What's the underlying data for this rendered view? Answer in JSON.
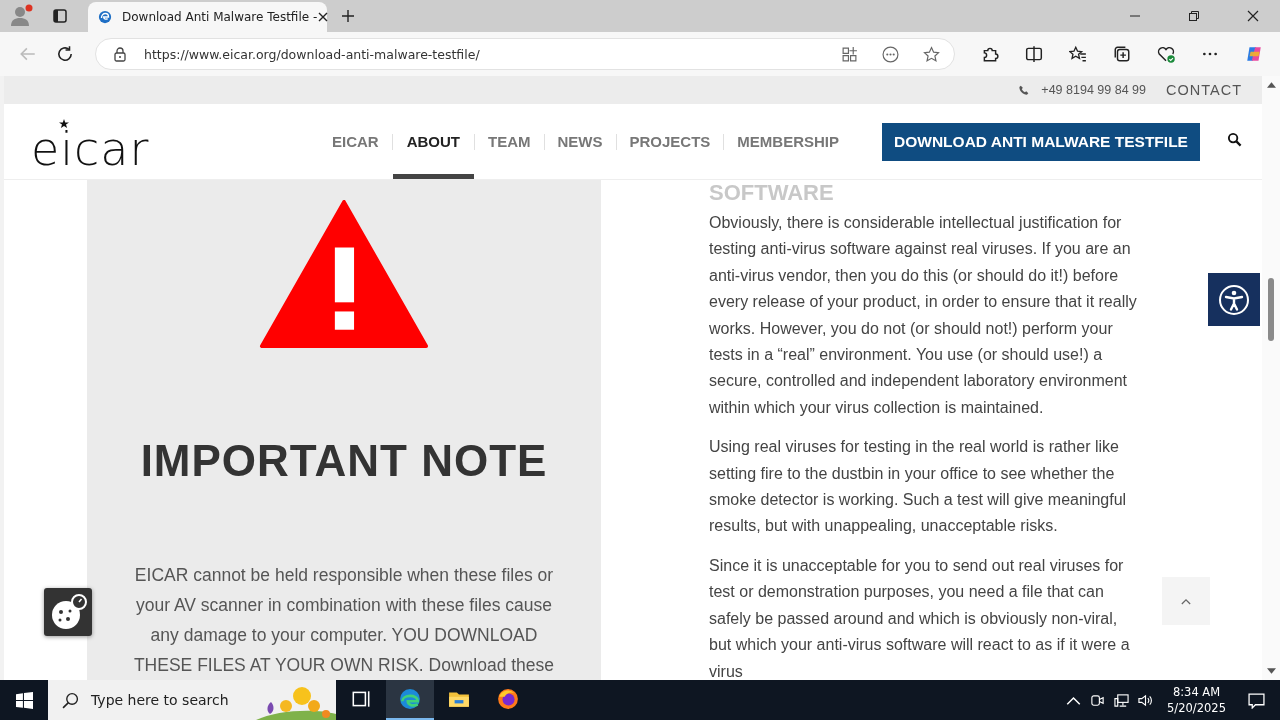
{
  "browser": {
    "tab": {
      "title": "Download Anti Malware Testfile -",
      "selected": true
    },
    "url": "https://www.eicar.org/download-anti-malware-testfile/"
  },
  "page": {
    "top_bar": {
      "phone": "+49 8194 99 84 99",
      "contact": "CONTACT"
    },
    "logo": "eicar",
    "nav": [
      {
        "label": "EICAR",
        "selected": false
      },
      {
        "label": "ABOUT",
        "selected": true
      },
      {
        "label": "TEAM",
        "selected": false
      },
      {
        "label": "NEWS",
        "selected": false
      },
      {
        "label": "PROJECTS",
        "selected": false
      },
      {
        "label": "MEMBERSHIP",
        "selected": false
      }
    ],
    "cta": "DOWNLOAD ANTI MALWARE TESTFILE",
    "note": {
      "title": "IMPORTANT NOTE",
      "text": "EICAR cannot be held responsible when these files or your AV scanner in combination with these files cause any damage to your computer. YOU DOWNLOAD THESE FILES AT YOUR OWN RISK. Download these"
    },
    "article": {
      "heading": "SOFTWARE",
      "paragraphs": [
        "Obviously, there is considerable intellectual justification for testing anti-virus software against real viruses. If you are an anti-virus vendor, then you do this (or should do it!) before every release of your product, in order to ensure that it really works. However, you do not (or should not!) perform your tests in a “real” environment. You use (or should use!) a secure, controlled and independent laboratory environment within which your virus collection is maintained.",
        "Using real viruses for testing in the real world is rather like setting fire to the dustbin in your office to see whether the smoke detector is working. Such a test will give meaningful results, but with unappealing, unacceptable risks.",
        "Since it is unacceptable for you to send out real viruses for test or demonstration purposes, you need a file that can safely be passed around and which is obviously non-viral, but which your anti-virus software will react to as if it were a virus"
      ]
    }
  },
  "taskbar": {
    "search": {
      "placeholder": "Type here to search"
    },
    "apps": [
      {
        "kind": "task-view",
        "selected": false
      },
      {
        "kind": "edge",
        "selected": true
      },
      {
        "kind": "explorer",
        "selected": false
      },
      {
        "kind": "firefox",
        "selected": false
      }
    ],
    "time": "8:34 AM",
    "date": "5/20/2025"
  }
}
